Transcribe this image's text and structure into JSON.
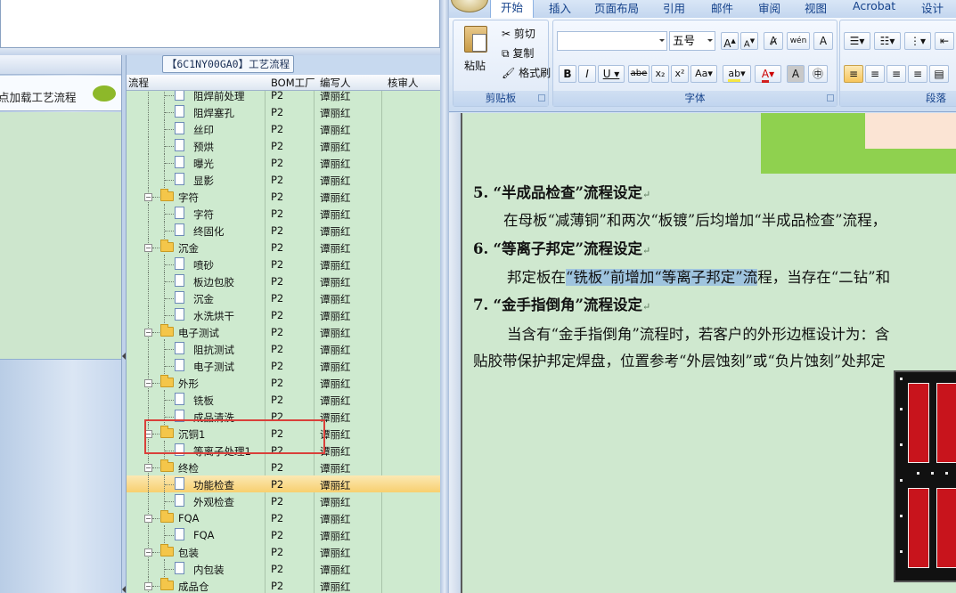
{
  "left_panel": {
    "load_process_label": "点加载工艺流程"
  },
  "flow": {
    "title": "【6C1NY00GA0】工艺流程",
    "columns": {
      "process": "流程",
      "bom_factory": "BOM工厂",
      "author": "编写人",
      "reviewer": "核审人"
    },
    "rows": [
      {
        "level": 2,
        "type": "doc",
        "name": "阻焊前处理",
        "factory": "P2",
        "author": "谭丽红",
        "partial": true
      },
      {
        "level": 2,
        "type": "doc",
        "name": "阻焊塞孔",
        "factory": "P2",
        "author": "谭丽红"
      },
      {
        "level": 2,
        "type": "doc",
        "name": "丝印",
        "factory": "P2",
        "author": "谭丽红"
      },
      {
        "level": 2,
        "type": "doc",
        "name": "预烘",
        "factory": "P2",
        "author": "谭丽红"
      },
      {
        "level": 2,
        "type": "doc",
        "name": "曝光",
        "factory": "P2",
        "author": "谭丽红"
      },
      {
        "level": 2,
        "type": "doc",
        "name": "显影",
        "factory": "P2",
        "author": "谭丽红"
      },
      {
        "level": 1,
        "type": "folder",
        "name": "字符",
        "factory": "P2",
        "author": "谭丽红"
      },
      {
        "level": 2,
        "type": "doc",
        "name": "字符",
        "factory": "P2",
        "author": "谭丽红"
      },
      {
        "level": 2,
        "type": "doc",
        "name": "终固化",
        "factory": "P2",
        "author": "谭丽红"
      },
      {
        "level": 1,
        "type": "folder",
        "name": "沉金",
        "factory": "P2",
        "author": "谭丽红"
      },
      {
        "level": 2,
        "type": "doc",
        "name": "喷砂",
        "factory": "P2",
        "author": "谭丽红"
      },
      {
        "level": 2,
        "type": "doc",
        "name": "板边包胶",
        "factory": "P2",
        "author": "谭丽红"
      },
      {
        "level": 2,
        "type": "doc",
        "name": "沉金",
        "factory": "P2",
        "author": "谭丽红"
      },
      {
        "level": 2,
        "type": "doc",
        "name": "水洗烘干",
        "factory": "P2",
        "author": "谭丽红"
      },
      {
        "level": 1,
        "type": "folder",
        "name": "电子测试",
        "factory": "P2",
        "author": "谭丽红"
      },
      {
        "level": 2,
        "type": "doc",
        "name": "阻抗测试",
        "factory": "P2",
        "author": "谭丽红"
      },
      {
        "level": 2,
        "type": "doc",
        "name": "电子测试",
        "factory": "P2",
        "author": "谭丽红"
      },
      {
        "level": 1,
        "type": "folder",
        "name": "外形",
        "factory": "P2",
        "author": "谭丽红"
      },
      {
        "level": 2,
        "type": "doc",
        "name": "铣板",
        "factory": "P2",
        "author": "谭丽红"
      },
      {
        "level": 2,
        "type": "doc",
        "name": "成品清洗",
        "factory": "P2",
        "author": "谭丽红"
      },
      {
        "level": 1,
        "type": "folder",
        "name": "沉铜1",
        "factory": "P2",
        "author": "谭丽红"
      },
      {
        "level": 2,
        "type": "doc",
        "name": "等离子处理1",
        "factory": "P2",
        "author": "谭丽红"
      },
      {
        "level": 1,
        "type": "folder",
        "name": "终检",
        "factory": "P2",
        "author": "谭丽红"
      },
      {
        "level": 2,
        "type": "doc",
        "name": "功能检查",
        "factory": "P2",
        "author": "谭丽红",
        "selected": true
      },
      {
        "level": 2,
        "type": "doc",
        "name": "外观检查",
        "factory": "P2",
        "author": "谭丽红"
      },
      {
        "level": 1,
        "type": "folder",
        "name": "FQA",
        "factory": "P2",
        "author": "谭丽红"
      },
      {
        "level": 2,
        "type": "doc",
        "name": "FQA",
        "factory": "P2",
        "author": "谭丽红"
      },
      {
        "level": 1,
        "type": "folder",
        "name": "包装",
        "factory": "P2",
        "author": "谭丽红"
      },
      {
        "level": 2,
        "type": "doc",
        "name": "内包装",
        "factory": "P2",
        "author": "谭丽红"
      },
      {
        "level": 1,
        "type": "folder",
        "name": "成品仓",
        "factory": "P2",
        "author": "谭丽红"
      }
    ]
  },
  "word": {
    "tabs": [
      "开始",
      "插入",
      "页面布局",
      "引用",
      "邮件",
      "审阅",
      "视图",
      "Acrobat",
      "设计"
    ],
    "clipboard": {
      "paste": "粘贴",
      "cut": "剪切",
      "copy": "复制",
      "format_painter": "格式刷",
      "group": "剪贴板"
    },
    "font": {
      "size": "五号",
      "group": "字体"
    },
    "paragraph": {
      "group": "段落"
    },
    "doc": {
      "h5_num": "5.",
      "h5": "“半成品检查”流程设定",
      "p5": "在母板“减薄铜”和两次“板镀”后均增加“半成品检查”流程，",
      "h6_num": "6.",
      "h6": "“等离子邦定”流程设定",
      "p6_pre": "邦定板在",
      "p6_hl": "“铣板”前增加“等离子邦定”流",
      "p6_post": "程，当存在“二钻”和",
      "h7_num": "7.",
      "h7": "“金手指倒角”流程设定",
      "p7a": "当含有“金手指倒角”流程时，若客户的外形边框设计为：含",
      "p7b": "贴胶带保护邦定焊盘，位置参考“外层蚀刻”或“负片蚀刻”处邦定"
    }
  }
}
